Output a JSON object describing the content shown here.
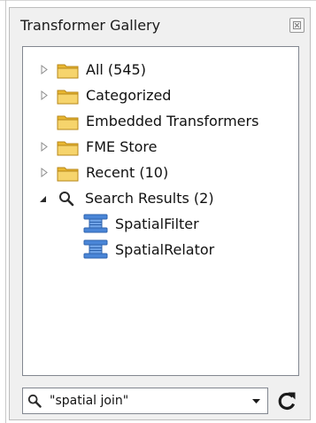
{
  "panel": {
    "title": "Transformer Gallery",
    "close_icon": "close-icon"
  },
  "tree": {
    "items": [
      {
        "label": "All (545)",
        "icon": "folder-icon",
        "expander": "collapsed"
      },
      {
        "label": "Categorized",
        "icon": "folder-icon",
        "expander": "collapsed"
      },
      {
        "label": "Embedded Transformers",
        "icon": "folder-icon",
        "expander": "none"
      },
      {
        "label": "FME Store",
        "icon": "folder-icon",
        "expander": "collapsed"
      },
      {
        "label": "Recent (10)",
        "icon": "folder-icon",
        "expander": "collapsed"
      },
      {
        "label": "Search Results (2)",
        "icon": "search-icon",
        "expander": "expanded"
      }
    ],
    "search_results": [
      {
        "label": "SpatialFilter",
        "icon": "transformer-icon"
      },
      {
        "label": "SpatialRelator",
        "icon": "transformer-icon"
      }
    ]
  },
  "search": {
    "value": "\"spatial join\"",
    "icon": "search-icon",
    "dropdown_icon": "dropdown-arrow-icon",
    "refresh_icon": "refresh-icon"
  },
  "colors": {
    "folder": "#f2c54b",
    "transformer": "#4a86d8",
    "panel_bg": "#f0f0f0"
  }
}
